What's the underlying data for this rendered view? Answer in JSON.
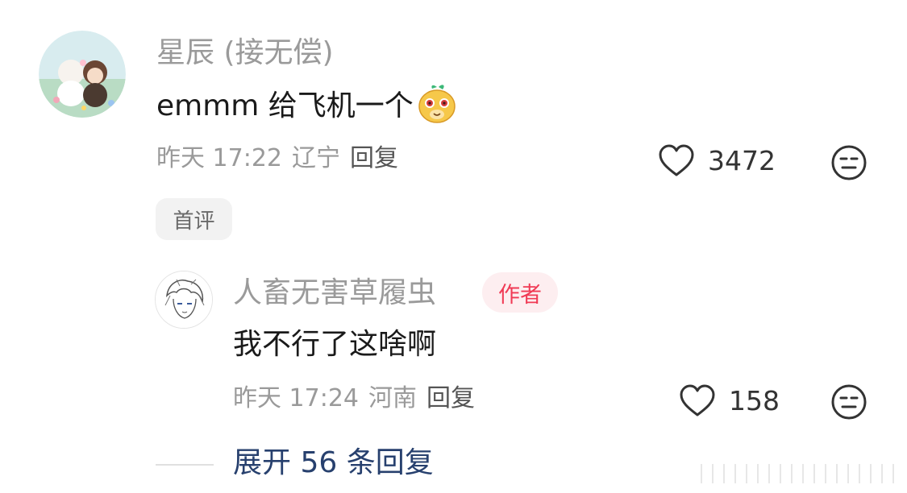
{
  "main_comment": {
    "username": "星辰 (接无偿)",
    "text": "emmm 给飞机一个",
    "emoji": "yellow-face-sticker",
    "time": "昨天 17:22",
    "location": "辽宁",
    "reply_label": "回复",
    "likes": "3472",
    "tag": "首评"
  },
  "reply_comment": {
    "username": "人畜无害草履虫",
    "badge": "作者",
    "text": "我不行了这啥啊",
    "time": "昨天 17:24",
    "location": "河南",
    "reply_label": "回复",
    "likes": "158"
  },
  "expand": {
    "label": "展开 56 条回复"
  },
  "colors": {
    "username": "#9a9a9a",
    "text": "#1a1a1a",
    "badge_bg": "#fdeef0",
    "badge_text": "#f03a55",
    "link": "#27406e"
  },
  "icons": {
    "like": "heart-outline-icon",
    "dislike": "neutral-face-icon"
  }
}
